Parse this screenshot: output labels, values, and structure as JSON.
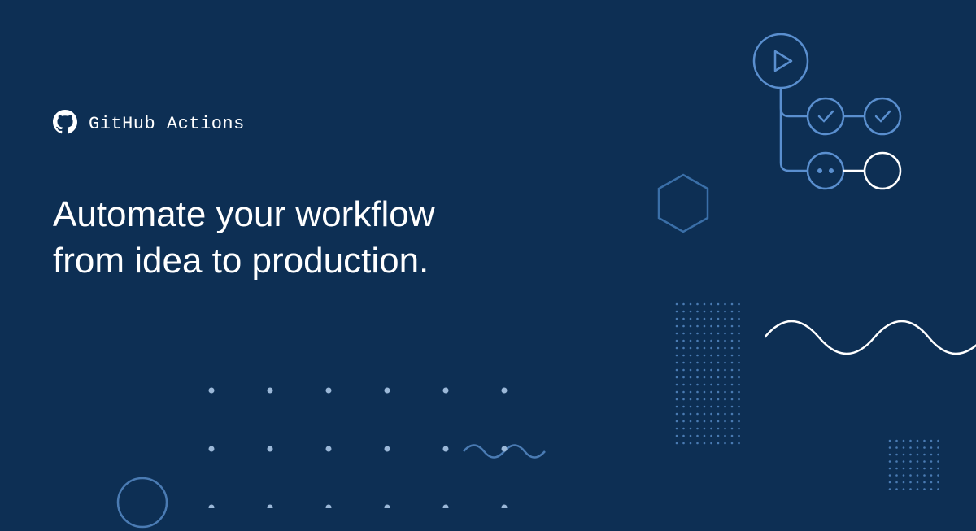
{
  "brand": {
    "name": "GitHub Actions"
  },
  "headline": {
    "line1": "Automate your workflow",
    "line2": "from idea to production."
  },
  "colors": {
    "background": "#0d2f54",
    "accent_blue": "#4184d3",
    "white": "#ffffff"
  }
}
